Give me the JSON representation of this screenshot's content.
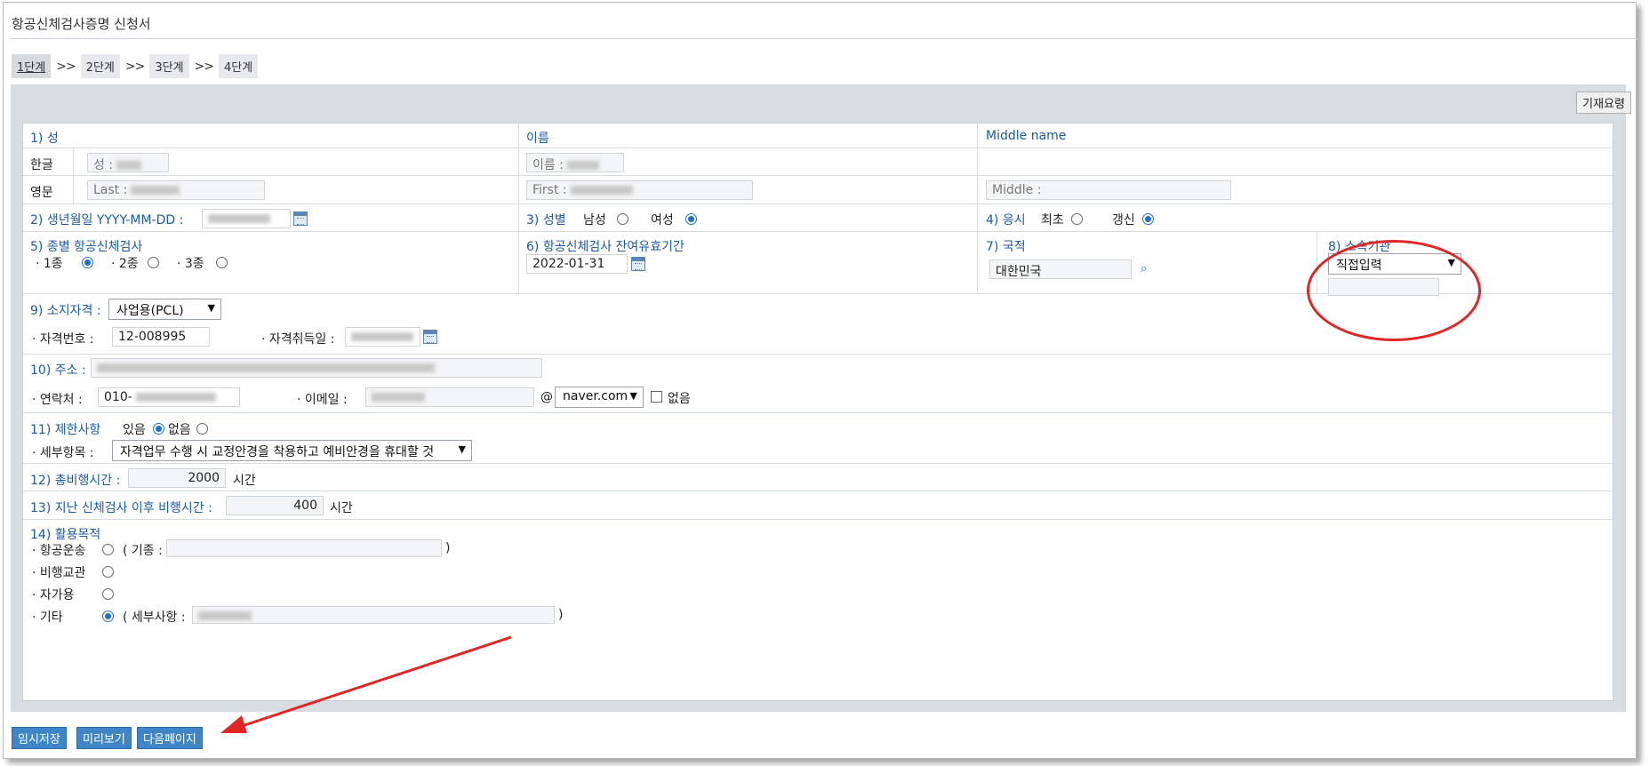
{
  "window_title": "항공신체검사증명 신청서",
  "steps": [
    "1단계",
    "2단계",
    "3단계",
    "4단계"
  ],
  "step_sep": ">>",
  "guide_button": "기재요령",
  "name": {
    "surname_label": "1) 성",
    "given_label": "이름",
    "middle_label": "Middle name",
    "korean_label": "한글",
    "english_label": "영문",
    "surname_prefix_ko": "성 :",
    "given_prefix_ko": "이름 :",
    "last_prefix_en": "Last :",
    "first_prefix_en": "First :",
    "middle_prefix_en": "Middle :"
  },
  "birth": {
    "label": "2) 생년월일 YYYY-MM-DD :"
  },
  "gender": {
    "label": "3) 성별",
    "male": "남성",
    "female": "여성",
    "selected": "female"
  },
  "apply": {
    "label": "4) 응시",
    "first": "최초",
    "renew": "갱신",
    "selected": "renew"
  },
  "class": {
    "label": "5) 종별 항공신체검사",
    "options": [
      "· 1종",
      "· 2종",
      "· 3종"
    ],
    "selected": 0
  },
  "validity": {
    "label": "6) 항공신체검사 잔여유효기간",
    "value": "2022-01-31"
  },
  "nationality": {
    "label": "7) 국적",
    "value": "대한민국"
  },
  "affiliation": {
    "label": "8) 소속기관",
    "select_value": "직접입력"
  },
  "license": {
    "label": "9) 소지자격 :",
    "select_value": "사업용(PCL)",
    "number_label": "· 자격번호 :",
    "number_value": "12-008995",
    "date_label": "· 자격취득일 :"
  },
  "address": {
    "label": "10) 주소 :",
    "phone_label": "· 연락처 :",
    "phone_prefix": "010-",
    "email_label": "· 이메일 :",
    "email_at": "@",
    "email_domain": "naver.com",
    "none_label": "없음"
  },
  "restriction": {
    "label": "11) 제한사항",
    "yes": "있음",
    "no": "없음",
    "selected": "yes",
    "detail_label": "· 세부항목 :",
    "detail_value": "자격업무 수행 시 교정안경을 착용하고 예비안경을 휴대할 것"
  },
  "total_flight": {
    "label": "12) 총비행시간 :",
    "value": "2000",
    "unit": "시간"
  },
  "recent_flight": {
    "label": "13) 지난 신체검사 이후 비행시간 :",
    "value": "400",
    "unit": "시간"
  },
  "purpose": {
    "label": "14) 활용목적",
    "items": [
      "· 항공운송",
      "· 비행교관",
      "· 자가용",
      "· 기타"
    ],
    "aircraft_open": "( 기종 :",
    "detail_open": "( 세부사항 :",
    "close": ")",
    "selected": 3
  },
  "buttons": {
    "save": "임시저장",
    "preview": "미리보기",
    "next": "다음페이지"
  },
  "annotation_color": "#e22525"
}
